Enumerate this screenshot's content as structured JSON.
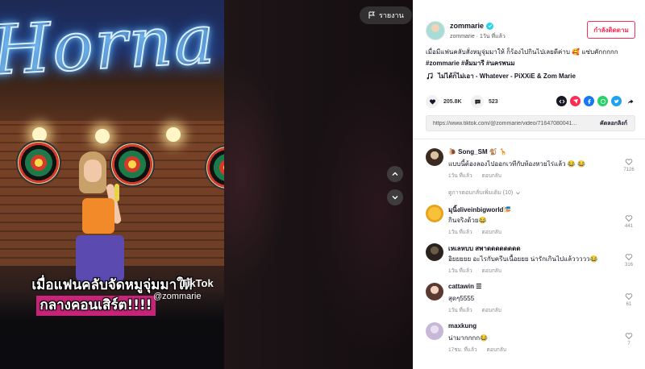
{
  "video": {
    "caption_line1": "เมื่อแฟนคลับจัดหมูจุ่มมาให้",
    "caption_line2": "กลางคอนเสิร์ต!!!!",
    "watermark_logo": "TikTok",
    "watermark_user": "@zommarie",
    "report_label": "รายงาน"
  },
  "author": {
    "name": "zommarie",
    "sub": "zommarie · 1วัน ที่แล้ว",
    "follow_label": "กำลังติดตาม"
  },
  "description": {
    "text": "เมื่อมีแฟนคลับสั่งหมูจุ่มมาให้ ก็ร้องไปกินไปเลยดีค่าบ 🥰 แซ่บคักกกกก",
    "tags": "#zommarie #ส้มมารี #นครพนม"
  },
  "music": {
    "title": "ไม่ได้ก็ไม่เอา - Whatever - PiXXiE & Zom Marie"
  },
  "stats": {
    "likes": "205.8K",
    "comments": "523"
  },
  "share": {
    "icons": [
      "embed-icon",
      "tiktok-friends-icon",
      "facebook-icon",
      "whatsapp-icon",
      "twitter-icon",
      "share-arrow-icon"
    ],
    "colors": {
      "embed": "#161823",
      "friends": "#fe2c55",
      "facebook": "#1877f2",
      "whatsapp": "#25d366",
      "twitter": "#1da1f2"
    }
  },
  "link": {
    "url": "https://www.tiktok.com/@zommarie/video/71647080041...",
    "copy_label": "คัดลอกลิงก์"
  },
  "comments": [
    {
      "name": "🐌 Song_SM 🐒 🦒",
      "text": "แบบนี้ต้องลองไปออกเวทีกับท้องหวยไร่แล้ว 😂 😂",
      "time": "1วัน ที่แล้ว",
      "reply": "ตอบกลับ",
      "likes": "7126",
      "view_replies": "ดูการตอบกลับเพิ่มเติม (10)"
    },
    {
      "name": "มุนิ้งliveinbigworld🎏",
      "text": "กินจริงด้วย😂",
      "time": "1วัน ที่แล้ว",
      "reply": "ตอบกลับ",
      "likes": "441"
    },
    {
      "name": "เหเลหบบ สพาดดดดดดดด",
      "text": "อิยยยยย อะไรกับครีบเนื้อยยย น่ารักเกินไปแล้ววววว😂",
      "time": "1วัน ที่แล้ว",
      "reply": "ตอบกลับ",
      "likes": "316"
    },
    {
      "name": "cattawin ☰",
      "text": "สุดๆ5555",
      "time": "1วัน ที่แล้ว",
      "reply": "ตอบกลับ",
      "likes": "61"
    },
    {
      "name": "maxkung",
      "text": "น่ามากกกก😂",
      "time": "17ชม. ที่แล้ว",
      "reply": "ตอบกลับ",
      "likes": "7"
    }
  ]
}
